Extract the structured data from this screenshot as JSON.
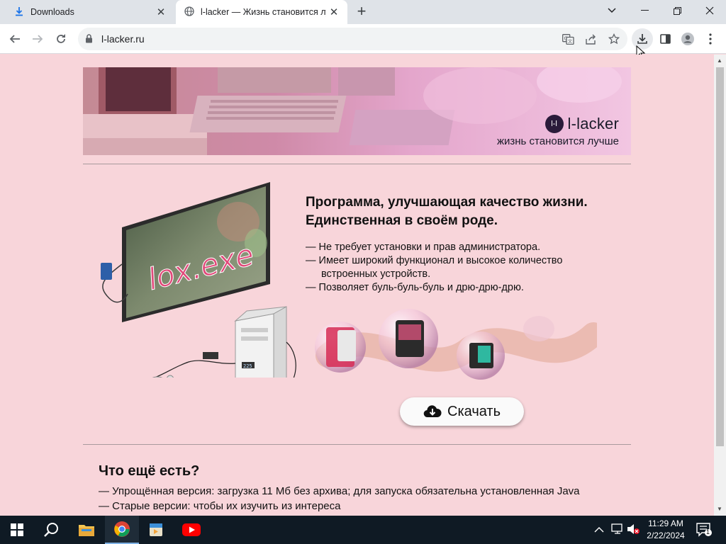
{
  "browser": {
    "tabs": [
      {
        "title": "Downloads",
        "icon": "download-icon"
      },
      {
        "title": "l-lacker — Жизнь становится лучше",
        "icon": "globe-icon"
      }
    ],
    "url": "l-lacker.ru"
  },
  "banner": {
    "brand_name": "l-lacker",
    "logo_text": "l-l",
    "slogan": "жизнь становится лучше"
  },
  "hero": {
    "screen_text": "lox.exe",
    "lcd_text": "225",
    "headline_line1": "Программа, улучшающая качество жизни.",
    "headline_line2": "Единственная в своём роде.",
    "features": [
      "— Не требует установки и прав администратора.",
      "— Имеет широкий функционал и высокое количество",
      "встроенных устройств.",
      "— Позволяет буль-буль-буль и дрю-дрю-дрю."
    ],
    "download_label": "Скачать"
  },
  "more": {
    "title": "Что ещё есть?",
    "items": [
      "— Упрощённая версия: загрузка 11 Мб без архива; для запуска обязательна установленная Java",
      "— Старые версии: чтобы их изучить из интереса"
    ]
  },
  "taskbar": {
    "time": "11:29 AM",
    "date": "2/22/2024",
    "notification_count": "1"
  },
  "colors": {
    "page_bg": "#f8d5da",
    "taskbar_bg": "#0f1a24",
    "tabstrip_bg": "#dfe3e8"
  }
}
